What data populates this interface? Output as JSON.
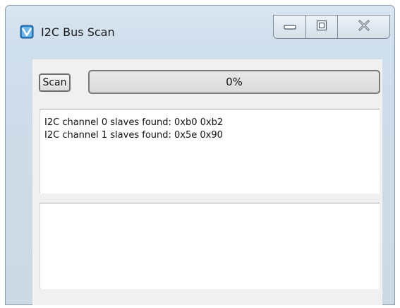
{
  "window": {
    "title": "I2C Bus Scan",
    "icon": "app-icon",
    "caption_buttons": [
      "minimize-icon",
      "maximize-icon",
      "close-icon"
    ]
  },
  "toolbar": {
    "scan_label": "Scan",
    "progress": {
      "value_percent": 0,
      "text": "0%"
    }
  },
  "output": {
    "lines": [
      "I2C channel 0 slaves found: 0xb0 0xb2",
      "I2C channel 1 slaves found: 0x5e 0x90"
    ]
  },
  "secondary_output": {
    "lines": []
  },
  "colors": {
    "window_frame": "#cfdeeb",
    "client_bg": "#f0f0f0",
    "text_area_bg": "#ffffff"
  }
}
